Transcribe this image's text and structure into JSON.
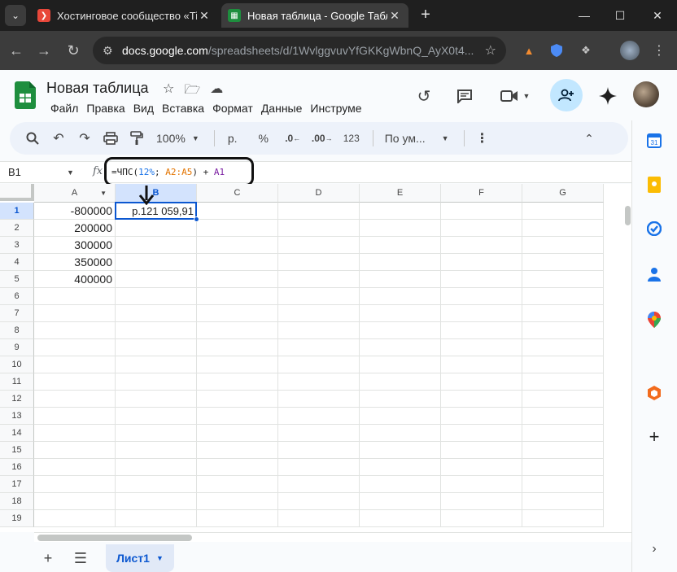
{
  "browser": {
    "tabs": [
      {
        "title": "Хостинговое сообщество «Tim",
        "active": false
      },
      {
        "title": "Новая таблица - Google Табли",
        "active": true
      }
    ],
    "new_tab": "+",
    "url_host": "docs.google.com",
    "url_path": "/spreadsheets/d/1WvlggvuvYfGKKgWbnQ_AyX0t4..."
  },
  "doc": {
    "title": "Новая таблица",
    "menu": [
      "Файл",
      "Правка",
      "Вид",
      "Вставка",
      "Формат",
      "Данные",
      "Инструме"
    ]
  },
  "toolbar": {
    "zoom": "100%",
    "currency": "р.",
    "percent": "%",
    "dec_decrease": ".0",
    "dec_increase": ".00",
    "number_format": "123",
    "font": "По ум...",
    "more": "⋮"
  },
  "formula_bar": {
    "name_box": "B1",
    "fx": "fx",
    "formula_prefix": "=ЧПС(",
    "formula_rate": "12%",
    "formula_sep": "; ",
    "formula_range": "A2:A5",
    "formula_mid": ") + ",
    "formula_ref": "A1"
  },
  "grid": {
    "columns": [
      "A",
      "B",
      "C",
      "D",
      "E",
      "F",
      "G"
    ],
    "selected_column": "B",
    "rows": [
      "1",
      "2",
      "3",
      "4",
      "5",
      "6",
      "7",
      "8",
      "9",
      "10",
      "11",
      "12",
      "13",
      "14",
      "15",
      "16",
      "17",
      "18",
      "19"
    ],
    "cells": {
      "A1": "-800000",
      "A2": "200000",
      "A3": "300000",
      "A4": "350000",
      "A5": "400000",
      "B1": "р.121 059,91"
    }
  },
  "sheets": {
    "active_sheet": "Лист1",
    "add": "+",
    "all_sheets": "☰"
  },
  "colors": {
    "accent": "#0b57d0",
    "formula_number": "#1a73e8",
    "formula_range": "#e37400",
    "formula_ref": "#7b1fa2"
  }
}
